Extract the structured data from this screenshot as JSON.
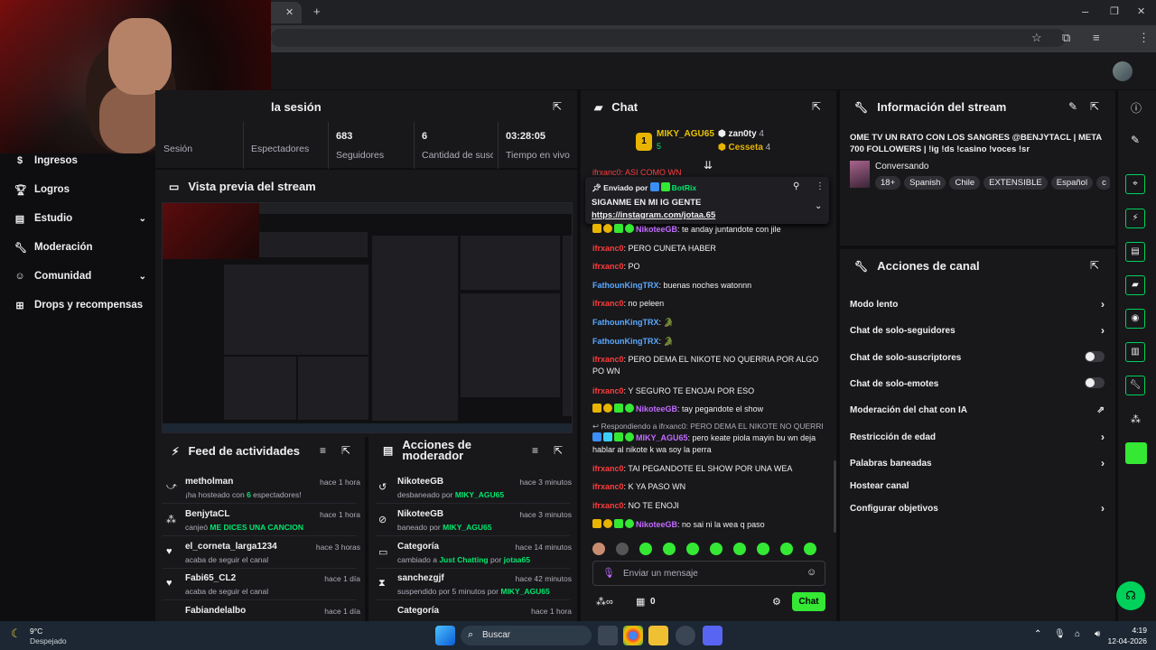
{
  "browser": {
    "close": "✕",
    "newtab": "+",
    "win_min": "–",
    "win_max": "❐",
    "win_close": "✕"
  },
  "nav": {
    "items": [
      {
        "label": "Ingresos",
        "icon": "dollar-icon"
      },
      {
        "label": "Logros",
        "icon": "trophy-icon"
      },
      {
        "label": "Estudio",
        "icon": "studio-icon",
        "chevron": true
      },
      {
        "label": "Moderación",
        "icon": "wrench-icon"
      },
      {
        "label": "Comunidad",
        "icon": "people-icon",
        "chevron": true
      },
      {
        "label": "Drops y recompensas",
        "icon": "drops-icon"
      }
    ]
  },
  "session": {
    "title": "la sesión",
    "stats": [
      {
        "value": "",
        "label": "Sesión"
      },
      {
        "value": "",
        "label": "Espectadores"
      },
      {
        "value": "683",
        "label": "Seguidores"
      },
      {
        "value": "6",
        "label": "Cantidad de suscripciones"
      },
      {
        "value": "03:28:05",
        "label": "Tiempo en vivo"
      }
    ]
  },
  "preview": {
    "title": "Vista previa del stream"
  },
  "activity": {
    "title": "Feed de actividades",
    "rows": [
      {
        "name": "metholman",
        "time": "hace 1 hora",
        "pre": "¡ha hosteado con ",
        "hl": "6",
        "post": " espectadores!"
      },
      {
        "name": "BenjytaCL",
        "time": "hace 1 hora",
        "pre": "canjeó ",
        "hl": "ME DICES UNA CANCION",
        "post": ""
      },
      {
        "name": "el_corneta_larga1234",
        "time": "hace 3 horas",
        "pre": "acaba de seguir el canal",
        "hl": "",
        "post": ""
      },
      {
        "name": "Fabi65_CL2",
        "time": "hace 1 día",
        "pre": "acaba de seguir el canal",
        "hl": "",
        "post": ""
      },
      {
        "name": "Fabiandelalbo",
        "time": "hace 1 día",
        "pre": "",
        "hl": "",
        "post": ""
      }
    ]
  },
  "mod": {
    "title": "Acciones de moderador",
    "rows": [
      {
        "name": "NikoteeGB",
        "time": "hace 3 minutos",
        "pre": "desbaneado por ",
        "hl": "MIKY_AGU65",
        "post": ""
      },
      {
        "name": "NikoteeGB",
        "time": "hace 3 minutos",
        "pre": "baneado por ",
        "hl": "MIKY_AGU65",
        "post": ""
      },
      {
        "name": "Categoría",
        "time": "hace 14 minutos",
        "pre": "cambiado a ",
        "hl": "Just Chatting",
        "post": " por ",
        "hl2": "jotaa65"
      },
      {
        "name": "sanchezgjf",
        "time": "hace 42 minutos",
        "pre": "suspendido por 5 minutos por ",
        "hl": "MIKY_AGU65",
        "post": ""
      },
      {
        "name": "Categoría",
        "time": "hace 1 hora",
        "pre": "",
        "hl": "",
        "post": ""
      }
    ]
  },
  "chat": {
    "title": "Chat",
    "leaders": {
      "first": "MIKY_AGU65",
      "first_count": "5",
      "second": "zan0ty",
      "second_count": "4",
      "third": "Cesseta",
      "third_count": "4"
    },
    "partial": "ifrxanc0: ASI COMO WN",
    "pinned": {
      "by": "Enviado por",
      "who": "BotRix",
      "text": "SIGANME EN MI IG GENTE",
      "link": "https://instagram.com/jotaa.65"
    },
    "messages": [
      {
        "user": "",
        "color": "",
        "text": "te anday juntandote con jile",
        "badges": true,
        "user2": "NikoteeGB"
      },
      {
        "user": "ifrxanc0",
        "color": "red",
        "text": "PERO CUNETA HABER"
      },
      {
        "user": "ifrxanc0",
        "color": "red",
        "text": "PO"
      },
      {
        "user": "FathounKingTRX",
        "color": "blue",
        "text": "buenas noches watonnn"
      },
      {
        "user": "ifrxanc0",
        "color": "red",
        "text": "no peleen"
      },
      {
        "user": "FathounKingTRX",
        "color": "blue",
        "text": "🐊"
      },
      {
        "user": "FathounKingTRX",
        "color": "blue",
        "text": "🐊"
      },
      {
        "user": "ifrxanc0",
        "color": "red",
        "text": "PERO DEMA EL NIKOTE NO QUERRIA POR ALGO PO WN"
      },
      {
        "user": "ifrxanc0",
        "color": "red",
        "text": "Y SEGURO TE ENOJAI POR ESO"
      },
      {
        "user": "NikoteeGB",
        "color": "purple",
        "text": "tay pegandote el show",
        "badges": true
      },
      {
        "reply": "Respondiendo a ifrxanc0: PERO DEMA EL NIKOTE NO QUERRI..."
      },
      {
        "user": "MIKY_AGU65",
        "color": "purple",
        "text": "pero keate piola mayin bu wn deja hablar al nikote k wa soy la perra",
        "badges": true
      },
      {
        "user": "ifrxanc0",
        "color": "red",
        "text": "TAI PEGANDOTE EL SHOW POR UNA WEA"
      },
      {
        "user": "ifrxanc0",
        "color": "red",
        "text": "K YA PASO WN"
      },
      {
        "user": "ifrxanc0",
        "color": "red",
        "text": "NO TE ENOJI"
      },
      {
        "user": "NikoteeGB",
        "color": "purple",
        "text": "no sai ni la wea q paso",
        "badges": true
      }
    ],
    "input_placeholder": "Enviar un mensaje",
    "points": "0",
    "send": "Chat"
  },
  "info": {
    "title": "Información del stream",
    "stream_title": "OME TV UN RATO CON LOS SANGRES @BENJYTACL | META 700 FOLLOWERS | !ig !ds !casino !voces !sr",
    "category": "Conversando",
    "tags": [
      "18+",
      "Spanish",
      "Chile",
      "EXTENSIBLE",
      "Español",
      "c"
    ]
  },
  "actions": {
    "title": "Acciones de canal",
    "items": [
      {
        "label": "Modo lento",
        "control": "chevron"
      },
      {
        "label": "Chat de solo-seguidores",
        "control": "chevron"
      },
      {
        "label": "Chat de solo-suscriptores",
        "control": "toggle"
      },
      {
        "label": "Chat de solo-emotes",
        "control": "toggle"
      },
      {
        "label": "Moderación del chat con IA",
        "control": "external"
      },
      {
        "label": "Restricción de edad",
        "control": "chevron"
      },
      {
        "label": "Palabras baneadas",
        "control": "chevron"
      },
      {
        "label": "Hostear canal",
        "control": "none"
      },
      {
        "label": "Configurar objetivos",
        "control": "chevron"
      }
    ]
  },
  "taskbar": {
    "weather_temp": "9°C",
    "weather_desc": "Despejado",
    "search": "Buscar",
    "time": "4:19",
    "date": "12-04-2026"
  },
  "colors": {
    "green": "#00e86e",
    "accent": "#53fc18"
  }
}
